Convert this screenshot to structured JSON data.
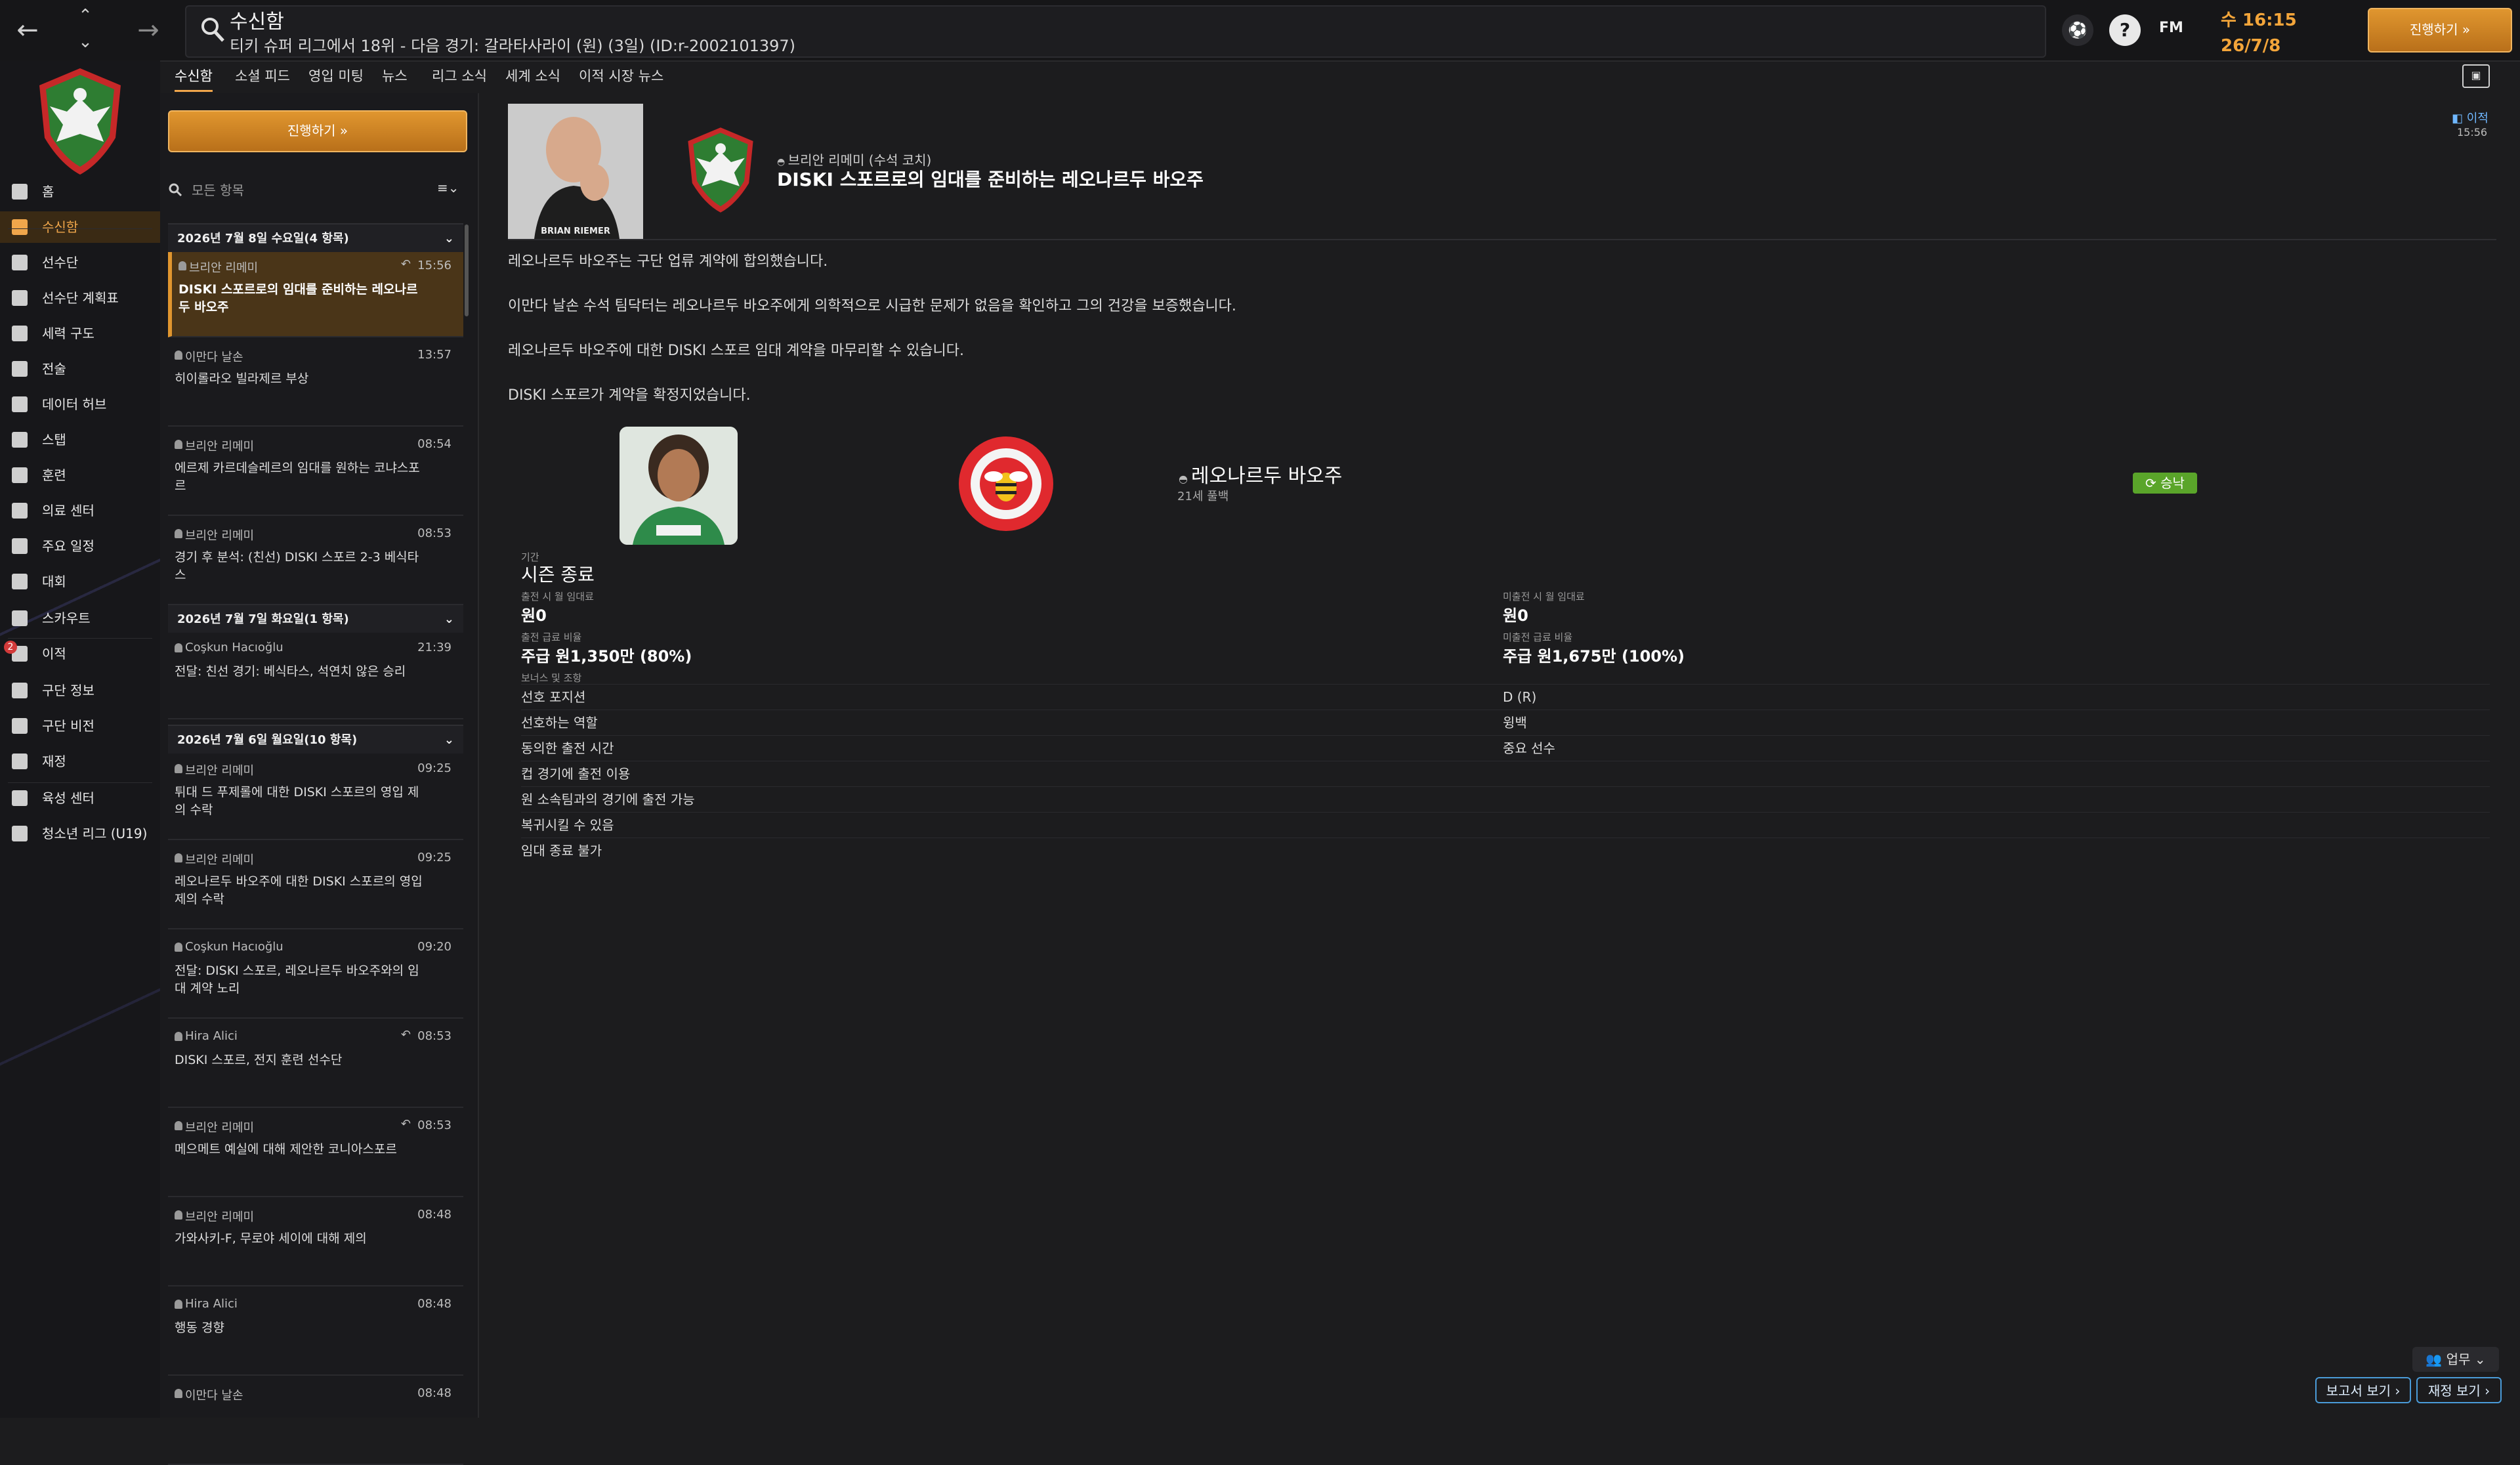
{
  "window": {
    "title": "수신함",
    "subtitle": "티키 슈퍼 리그에서 18위 - 다음 경기: 갈라타사라이 (원) (3일) (ID:r-2002101397)",
    "clock_time": "수 16:15",
    "clock_date": "26/7/8",
    "continue_label": "진행하기 »",
    "fm_label": "FM"
  },
  "sidebar": {
    "items": [
      {
        "label": "홈",
        "icon": "home-icon"
      },
      {
        "label": "수신함",
        "icon": "inbox-icon",
        "active": true
      },
      {
        "label": "선수단",
        "icon": "shirt-icon"
      },
      {
        "label": "선수단 계획표",
        "icon": "clipboard-icon"
      },
      {
        "label": "세력 구도",
        "icon": "hierarchy-icon"
      },
      {
        "label": "전술",
        "icon": "tactics-icon"
      },
      {
        "label": "데이터 허브",
        "icon": "data-icon"
      },
      {
        "label": "스탭",
        "icon": "staff-icon"
      },
      {
        "label": "훈련",
        "icon": "training-icon"
      },
      {
        "label": "의료 센터",
        "icon": "medical-icon"
      },
      {
        "label": "주요 일정",
        "icon": "calendar-icon"
      },
      {
        "label": "대회",
        "icon": "trophy-icon"
      },
      {
        "label": "스카우트",
        "icon": "scout-icon"
      },
      {
        "label": "이적",
        "icon": "transfer-icon",
        "badge": "2"
      },
      {
        "label": "구단 정보",
        "icon": "shield-icon"
      },
      {
        "label": "구단 비전",
        "icon": "vision-icon"
      },
      {
        "label": "재정",
        "icon": "finance-icon"
      },
      {
        "label": "육성 센터",
        "icon": "development-icon"
      },
      {
        "label": "청소년 리그 (U19)",
        "icon": "youth-icon"
      }
    ]
  },
  "tabs": [
    "수신함",
    "소셜 피드",
    "영입 미팅",
    "뉴스",
    "리그 소식",
    "세계 소식",
    "이적 시장 뉴스"
  ],
  "inbox": {
    "continue_label": "진행하기 »",
    "filter_placeholder": "모든 항목",
    "groups": [
      {
        "label": "2026년 7월 8일 수요일(4 항목)"
      },
      {
        "label": "2026년 7월 7일 화요일(1 항목)"
      },
      {
        "label": "2026년 7월 6일 월요일(10 항목)"
      }
    ],
    "messages": [
      {
        "sender": "브리안 리메미",
        "time": "15:56",
        "subject": "DISKI 스포르로의 임대를 준비하는 레오나르두 바오주",
        "replied": "↶"
      },
      {
        "sender": "이만다 날손",
        "time": "13:57",
        "subject": "히이롤라오 빌라제르 부상"
      },
      {
        "sender": "브리안 리메미",
        "time": "08:54",
        "subject": "에르제 카르데슬레르의 임대를 원하는 코냐스포르"
      },
      {
        "sender": "브리안 리메미",
        "time": "08:53",
        "subject": "경기 후 분석: (친선) DISKI 스포르 2-3 베식타스"
      },
      {
        "sender": "Coşkun Hacıoğlu",
        "time": "21:39",
        "subject": "전달: 친선 경기: 베식타스, 석연치 않은 승리"
      },
      {
        "sender": "브리안 리메미",
        "time": "09:25",
        "subject": "튀대 드 푸제롤에 대한 DISKI 스포르의 영입 제의 수락"
      },
      {
        "sender": "브리안 리메미",
        "time": "09:25",
        "subject": "레오나르두 바오주에 대한 DISKI 스포르의 영입 제의 수락"
      },
      {
        "sender": "Coşkun Hacıoğlu",
        "time": "09:20",
        "subject": "전달: DISKI 스포르, 레오나르두 바오주와의 임대 계약 노리"
      },
      {
        "sender": "Hira Alici",
        "time": "08:53",
        "subject": "DISKI 스포르, 전지 훈련 선수단",
        "replied": "↶"
      },
      {
        "sender": "브리안 리메미",
        "time": "08:53",
        "subject": "메으메트 예실에 대해 제안한 코니아스포르",
        "replied": "↶"
      },
      {
        "sender": "브리안 리메미",
        "time": "08:48",
        "subject": "가와사키-F, 무로야 세이에 대해 제의"
      },
      {
        "sender": "Hira Alici",
        "time": "08:48",
        "subject": "행동 경향"
      },
      {
        "sender": "이만다 날손",
        "time": "08:48",
        "subject": ""
      }
    ]
  },
  "message": {
    "coach_caption": "BRIAN RIEMER",
    "from": "브리안 리메미 (수석 코치)",
    "heading": "DISKI 스포르로의 임대를 준비하는 레오나르두 바오주",
    "tag": "이적",
    "tag_time": "15:56",
    "paragraphs": [
      "레오나르두 바오주는 구단 업류 계약에 합의했습니다.",
      "이만다 날손 수석 팀닥터는 레오나르두 바오주에게 의학적으로 시급한 문제가 없음을 확인하고 그의 건강을 보증했습니다.",
      "레오나르두 바오주에 대한 DISKI 스포르 임대 계약을 마무리할 수 있습니다.",
      "DISKI 스포르가 계약을 확정지었습니다."
    ],
    "player_name": "레오나르두 바오주",
    "player_sub": "21세 풀백",
    "status": "승낙",
    "period_label": "기간",
    "period_value": "시즌 종료",
    "fee_on_play_label": "출전 시 월 임대료",
    "fee_on_play_value": "원0",
    "fee_no_play_label": "미출전 시 월 임대료",
    "fee_no_play_value": "원0",
    "wage_label": "출전 급료 비율",
    "wage_value": "주급 원1,350만 (80%)",
    "wage_no_play_label": "미출전 급료 비율",
    "wage_no_play_value": "주급 원1,675만 (100%)",
    "clauses_label": "보너스 및 조항",
    "clauses": [
      {
        "label": "선호 포지션",
        "value": "D (R)"
      },
      {
        "label": "선호하는 역할",
        "value": "윙백"
      },
      {
        "label": "동의한 출전 시간",
        "value": "중요 선수"
      },
      {
        "label": "컵 경기에 출전 이용",
        "value": ""
      },
      {
        "label": "원 소속팀과의 경기에 출전 가능",
        "value": ""
      },
      {
        "label": "복귀시킬 수 있음",
        "value": ""
      },
      {
        "label": "임대 종료 불가",
        "value": ""
      }
    ]
  },
  "footer": {
    "work_label": "업무",
    "report_label": "보고서 보기",
    "finance_label": "재정 보기"
  },
  "colors": {
    "accent": "#f0a64b",
    "bg": "#1c1c1e",
    "status_green": "#5aa52a"
  }
}
